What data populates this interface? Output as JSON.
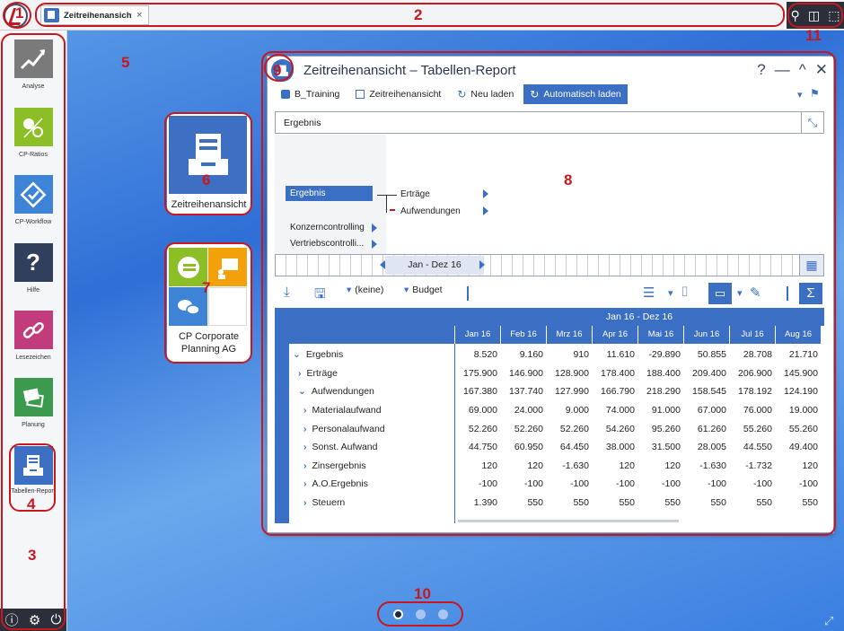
{
  "callouts": [
    "1",
    "2",
    "3",
    "4",
    "5",
    "6",
    "7",
    "8",
    "9",
    "10",
    "11"
  ],
  "topbar": {
    "tab_label": "Zeitreihenansicht...",
    "tab_close": "×",
    "tools": [
      "search-icon",
      "layout-icon",
      "fullscreen-icon"
    ]
  },
  "sidebar": {
    "items": [
      {
        "label": "Analyse",
        "icon": "chart-up-icon",
        "color": "#7a7a7a"
      },
      {
        "label": "CP-Ratios",
        "icon": "ratio-icon",
        "color": "#8cbf26"
      },
      {
        "label": "CP-Workflow",
        "icon": "workflow-icon",
        "color": "#3d84d6"
      },
      {
        "label": "Hilfe",
        "icon": "help-icon",
        "color": "#2f3f5c",
        "glyph": "?"
      },
      {
        "label": "Lesezeichen",
        "icon": "link-icon",
        "color": "#c23b7c"
      },
      {
        "label": "Planung",
        "icon": "planning-icon",
        "color": "#3b9a4d"
      },
      {
        "label": "Tabellen-Report",
        "icon": "table-report-icon",
        "color": "#3d6fc3"
      }
    ],
    "bottom_icons": [
      "info-icon",
      "settings-icon",
      "power-icon"
    ]
  },
  "desktop": {
    "tile_zeitreihen": {
      "label": "Zeitreihenansicht"
    },
    "tile_cp": {
      "label_line1": "CP Corporate",
      "label_line2": "Planning AG"
    }
  },
  "window": {
    "title": "Zeitreihenansicht – Tabellen-Report",
    "controls": [
      "?",
      "—",
      "^",
      "✕"
    ],
    "toolbar": [
      {
        "label": "B_Training",
        "icon": "database-icon",
        "active": false
      },
      {
        "label": "Zeitreihenansicht",
        "icon": "document-icon",
        "active": false
      },
      {
        "label": "Neu laden",
        "icon": "reload-icon",
        "active": false
      },
      {
        "label": "Automatisch laden",
        "icon": "auto-reload-icon",
        "active": true
      }
    ],
    "ergebnis_bar": "Ergebnis",
    "tree": {
      "selected": "Ergebnis",
      "others": [
        "Konzerncontrolling",
        "Vertriebscontrolli..."
      ],
      "children": [
        "Erträge",
        "Aufwendungen"
      ]
    },
    "timeline": {
      "range": "Jan - Dez 16"
    },
    "toolbar2": {
      "filter1": "(keine)",
      "filter2": "Budget",
      "sum": "Σ"
    },
    "table": {
      "period": "Jan 16 - Dez 16",
      "columns": [
        "Jan 16",
        "Feb 16",
        "Mrz 16",
        "Apr 16",
        "Mai 16",
        "Jun 16",
        "Jul 16",
        "Aug 16"
      ],
      "rows": [
        {
          "label": "Ergebnis",
          "marker": "v",
          "values": [
            "8.520",
            "9.160",
            "910",
            "11.610",
            "-29.890",
            "50.855",
            "28.708",
            "21.710"
          ]
        },
        {
          "label": "Erträge",
          "marker": ">",
          "values": [
            "175.900",
            "146.900",
            "128.900",
            "178.400",
            "188.400",
            "209.400",
            "206.900",
            "145.900"
          ]
        },
        {
          "label": "Aufwendungen",
          "marker": "v",
          "values": [
            "167.380",
            "137.740",
            "127.990",
            "166.790",
            "218.290",
            "158.545",
            "178.192",
            "124.190"
          ]
        },
        {
          "label": "Materialaufwand",
          "marker": ">",
          "values": [
            "69.000",
            "24.000",
            "9.000",
            "74.000",
            "91.000",
            "67.000",
            "76.000",
            "19.000"
          ]
        },
        {
          "label": "Personalaufwand",
          "marker": ">",
          "values": [
            "52.260",
            "52.260",
            "52.260",
            "54.260",
            "95.260",
            "61.260",
            "55.260",
            "55.260"
          ]
        },
        {
          "label": "Sonst. Aufwand",
          "marker": ">",
          "values": [
            "44.750",
            "60.950",
            "64.450",
            "38.000",
            "31.500",
            "28.005",
            "44.550",
            "49.400"
          ]
        },
        {
          "label": "Zinsergebnis",
          "marker": ">",
          "values": [
            "120",
            "120",
            "-1.630",
            "120",
            "120",
            "-1.630",
            "-1.732",
            "120"
          ]
        },
        {
          "label": "A.O.Ergebnis",
          "marker": ">",
          "values": [
            "-100",
            "-100",
            "-100",
            "-100",
            "-100",
            "-100",
            "-100",
            "-100"
          ]
        },
        {
          "label": "Steuern",
          "marker": ">",
          "values": [
            "1.390",
            "550",
            "550",
            "550",
            "550",
            "550",
            "550",
            "550"
          ]
        }
      ]
    }
  },
  "pager": {
    "dots": 3,
    "active": 0
  }
}
